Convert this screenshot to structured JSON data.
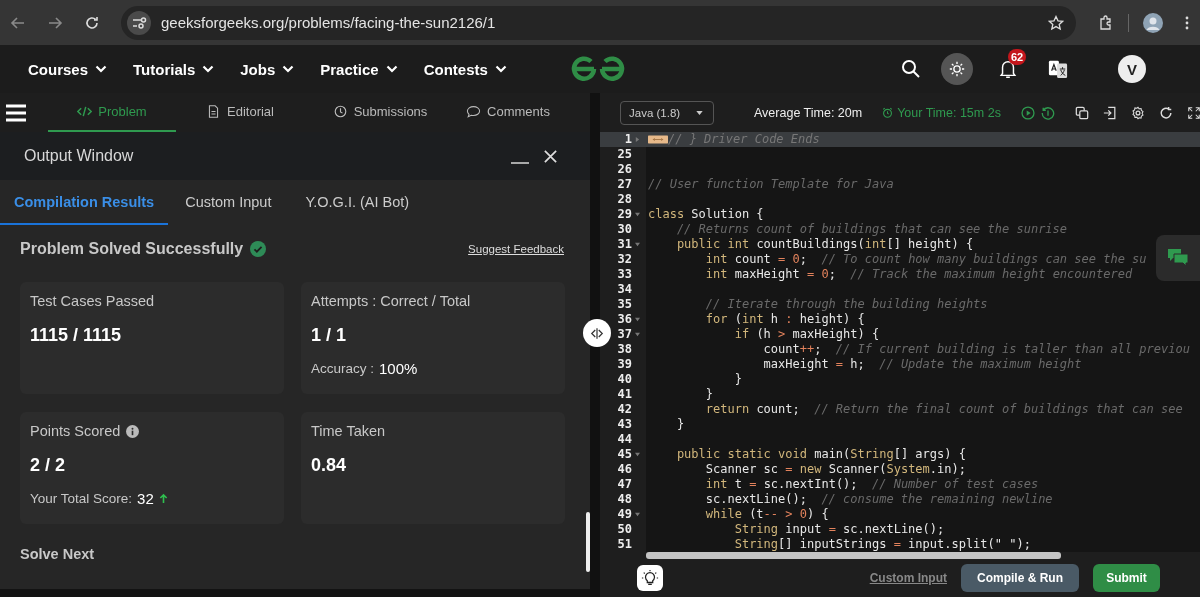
{
  "browser": {
    "url": "geeksforgeeks.org/problems/facing-the-sun2126/1"
  },
  "nav": {
    "items": [
      "Courses",
      "Tutorials",
      "Jobs",
      "Practice",
      "Contests"
    ],
    "notifications": "62",
    "avatar": "V"
  },
  "problem_tabs": [
    {
      "label": "Problem",
      "kind": "code",
      "selected": true
    },
    {
      "label": "Editorial",
      "kind": "document",
      "selected": false
    },
    {
      "label": "Submissions",
      "kind": "clock",
      "selected": false
    },
    {
      "label": "Comments",
      "kind": "comment",
      "selected": false
    }
  ],
  "output_window": {
    "title": "Output Window",
    "tabs": [
      {
        "label": "Compilation Results",
        "selected": true
      },
      {
        "label": "Custom Input",
        "selected": false
      },
      {
        "label": "Y.O.G.I. (AI Bot)",
        "selected": false
      }
    ],
    "status": "Problem Solved Successfully",
    "feedback_link": "Suggest Feedback",
    "cards": [
      {
        "label": "Test Cases Passed",
        "info": false,
        "value": "1115 / 1115",
        "arrow_up": false
      },
      {
        "label": "Attempts : Correct / Total",
        "info": false,
        "value": "1 / 1",
        "note_label": "Accuracy :",
        "note_value": "100%",
        "arrow_up": false
      },
      {
        "label": "Points Scored",
        "info": true,
        "value": "2 / 2",
        "note_label": "Your Total Score:",
        "note_value": "32",
        "arrow_up": true
      },
      {
        "label": "Time Taken",
        "info": false,
        "value": "0.84",
        "arrow_up": false
      }
    ],
    "next_heading": "Solve Next"
  },
  "editor": {
    "language": "Java (1.8)",
    "average_time": "Average Time: 20m",
    "your_time": "Your Time: 15m 2s",
    "lines": [
      {
        "number": "1",
        "fold": true,
        "current": true,
        "folded": true,
        "tokens": [
          {
            "kind": "c",
            "text": "// } Driver Code Ends"
          }
        ]
      },
      {
        "number": "25",
        "fold": false,
        "current": false,
        "folded": false
      },
      {
        "number": "26",
        "fold": false,
        "current": false,
        "folded": false
      },
      {
        "number": "27",
        "fold": false,
        "current": false,
        "folded": false,
        "tokens": [
          {
            "kind": "c",
            "text": "// User function Template for Java"
          }
        ]
      },
      {
        "number": "28",
        "fold": false,
        "current": false,
        "folded": false
      },
      {
        "number": "29",
        "fold": true,
        "current": false,
        "folded": false,
        "tokens": [
          {
            "kind": "k",
            "text": "class"
          },
          {
            "kind": "t",
            "text": " Solution {"
          }
        ]
      },
      {
        "number": "30",
        "fold": false,
        "current": false,
        "folded": false,
        "tokens": [
          {
            "kind": "c",
            "text": "    // Returns count of buildings that can see the sunrise"
          }
        ]
      },
      {
        "number": "31",
        "fold": true,
        "current": false,
        "folded": false,
        "tokens": [
          {
            "kind": "k",
            "text": "    public int"
          },
          {
            "kind": "t",
            "text": " countBuildings("
          },
          {
            "kind": "k",
            "text": "int"
          },
          {
            "kind": "t",
            "text": "[] height) {"
          }
        ]
      },
      {
        "number": "32",
        "fold": false,
        "current": false,
        "folded": false,
        "tokens": [
          {
            "kind": "k",
            "text": "        int"
          },
          {
            "kind": "t",
            "text": " count "
          },
          {
            "kind": "n",
            "text": "= 0"
          },
          {
            "kind": "t",
            "text": ";  "
          },
          {
            "kind": "c",
            "text": "// To count how many buildings can see the su"
          }
        ]
      },
      {
        "number": "33",
        "fold": false,
        "current": false,
        "folded": false,
        "tokens": [
          {
            "kind": "k",
            "text": "        int"
          },
          {
            "kind": "t",
            "text": " maxHeight "
          },
          {
            "kind": "n",
            "text": "= 0"
          },
          {
            "kind": "t",
            "text": ";  "
          },
          {
            "kind": "c",
            "text": "// Track the maximum height encountered"
          }
        ]
      },
      {
        "number": "34",
        "fold": false,
        "current": false,
        "folded": false
      },
      {
        "number": "35",
        "fold": false,
        "current": false,
        "folded": false,
        "tokens": [
          {
            "kind": "c",
            "text": "        // Iterate through the building heights"
          }
        ]
      },
      {
        "number": "36",
        "fold": true,
        "current": false,
        "folded": false,
        "tokens": [
          {
            "kind": "k",
            "text": "        for"
          },
          {
            "kind": "t",
            "text": " ("
          },
          {
            "kind": "k",
            "text": "int"
          },
          {
            "kind": "t",
            "text": " h "
          },
          {
            "kind": "n",
            "text": ":"
          },
          {
            "kind": "t",
            "text": " height) {"
          }
        ]
      },
      {
        "number": "37",
        "fold": true,
        "current": false,
        "folded": false,
        "tokens": [
          {
            "kind": "k",
            "text": "            if"
          },
          {
            "kind": "t",
            "text": " (h "
          },
          {
            "kind": "n",
            "text": ">"
          },
          {
            "kind": "t",
            "text": " maxHeight) {"
          }
        ]
      },
      {
        "number": "38",
        "fold": false,
        "current": false,
        "folded": false,
        "tokens": [
          {
            "kind": "t",
            "text": "                count"
          },
          {
            "kind": "n",
            "text": "++"
          },
          {
            "kind": "t",
            "text": ";  "
          },
          {
            "kind": "c",
            "text": "// If current building is taller than all previou"
          }
        ]
      },
      {
        "number": "39",
        "fold": false,
        "current": false,
        "folded": false,
        "tokens": [
          {
            "kind": "t",
            "text": "                maxHeight "
          },
          {
            "kind": "n",
            "text": "="
          },
          {
            "kind": "t",
            "text": " h;  "
          },
          {
            "kind": "c",
            "text": "// Update the maximum height"
          }
        ]
      },
      {
        "number": "40",
        "fold": false,
        "current": false,
        "folded": false,
        "tokens": [
          {
            "kind": "t",
            "text": "            }"
          }
        ]
      },
      {
        "number": "41",
        "fold": false,
        "current": false,
        "folded": false,
        "tokens": [
          {
            "kind": "t",
            "text": "        }"
          }
        ]
      },
      {
        "number": "42",
        "fold": false,
        "current": false,
        "folded": false,
        "tokens": [
          {
            "kind": "k",
            "text": "        return"
          },
          {
            "kind": "t",
            "text": " count;  "
          },
          {
            "kind": "c",
            "text": "// Return the final count of buildings that can see"
          }
        ]
      },
      {
        "number": "43",
        "fold": false,
        "current": false,
        "folded": false,
        "tokens": [
          {
            "kind": "t",
            "text": "    }"
          }
        ]
      },
      {
        "number": "44",
        "fold": false,
        "current": false,
        "folded": false
      },
      {
        "number": "45",
        "fold": true,
        "current": false,
        "folded": false,
        "tokens": [
          {
            "kind": "k",
            "text": "    public static void"
          },
          {
            "kind": "t",
            "text": " main("
          },
          {
            "kind": "k",
            "text": "String"
          },
          {
            "kind": "t",
            "text": "[] args) {"
          }
        ]
      },
      {
        "number": "46",
        "fold": false,
        "current": false,
        "folded": false,
        "tokens": [
          {
            "kind": "t",
            "text": "        Scanner sc "
          },
          {
            "kind": "n",
            "text": "="
          },
          {
            "kind": "k",
            "text": " new"
          },
          {
            "kind": "t",
            "text": " Scanner("
          },
          {
            "kind": "k",
            "text": "System"
          },
          {
            "kind": "t",
            "text": ".in);"
          }
        ]
      },
      {
        "number": "47",
        "fold": false,
        "current": false,
        "folded": false,
        "tokens": [
          {
            "kind": "k",
            "text": "        int"
          },
          {
            "kind": "t",
            "text": " t "
          },
          {
            "kind": "n",
            "text": "="
          },
          {
            "kind": "t",
            "text": " sc.nextInt();  "
          },
          {
            "kind": "c",
            "text": "// Number of test cases"
          }
        ]
      },
      {
        "number": "48",
        "fold": false,
        "current": false,
        "folded": false,
        "tokens": [
          {
            "kind": "t",
            "text": "        sc.nextLine();  "
          },
          {
            "kind": "c",
            "text": "// consume the remaining newline"
          }
        ]
      },
      {
        "number": "49",
        "fold": true,
        "current": false,
        "folded": false,
        "tokens": [
          {
            "kind": "k",
            "text": "        while"
          },
          {
            "kind": "t",
            "text": " (t"
          },
          {
            "kind": "n",
            "text": "-- > 0"
          },
          {
            "kind": "t",
            "text": ") {"
          }
        ]
      },
      {
        "number": "50",
        "fold": false,
        "current": false,
        "folded": false,
        "tokens": [
          {
            "kind": "k",
            "text": "            String"
          },
          {
            "kind": "t",
            "text": " input "
          },
          {
            "kind": "n",
            "text": "="
          },
          {
            "kind": "t",
            "text": " sc.nextLine();"
          }
        ]
      },
      {
        "number": "51",
        "fold": false,
        "current": false,
        "folded": false,
        "tokens": [
          {
            "kind": "k",
            "text": "            String"
          },
          {
            "kind": "t",
            "text": "[] inputStrings "
          },
          {
            "kind": "n",
            "text": "="
          },
          {
            "kind": "t",
            "text": " input.split(\" \");"
          }
        ]
      }
    ]
  },
  "actions": {
    "custom_input": "Custom Input",
    "compile": "Compile & Run",
    "submit": "Submit"
  }
}
